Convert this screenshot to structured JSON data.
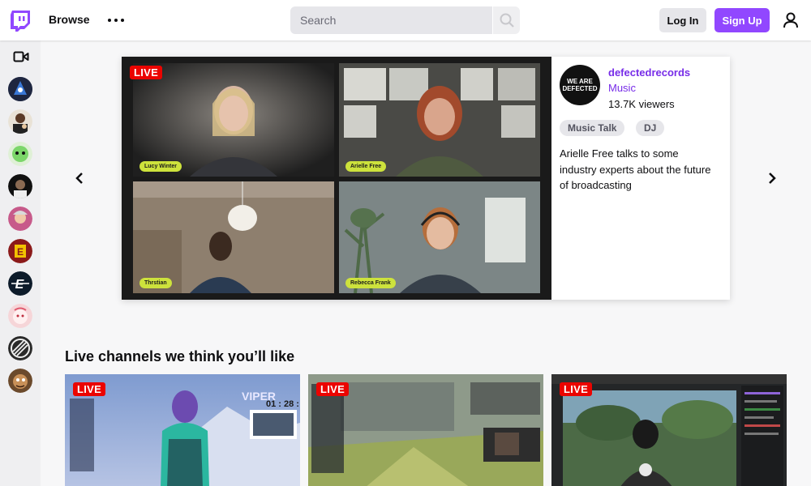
{
  "nav": {
    "browse_label": "Browse",
    "search_placeholder": "Search",
    "login_label": "Log In",
    "signup_label": "Sign Up"
  },
  "featured": {
    "live_label": "LIVE",
    "channel_name": "defectedrecords",
    "category": "Music",
    "viewers": "13.7K viewers",
    "tags": [
      "Music Talk",
      "DJ"
    ],
    "description": "Arielle Free talks to some industry experts about the future of broadcasting",
    "avatar_text": "WE ARE DEFECTED",
    "participants": [
      "Lucy Winter",
      "Arielle Free",
      "Thrstian",
      "Rebecca Frank"
    ]
  },
  "live_section": {
    "title": "Live channels we think you’ll like",
    "cards": [
      {
        "live_label": "LIVE"
      },
      {
        "live_label": "LIVE"
      },
      {
        "live_label": "LIVE"
      }
    ]
  },
  "colors": {
    "brand": "#9147ff",
    "live": "#eb0400",
    "link": "#772ce8"
  }
}
